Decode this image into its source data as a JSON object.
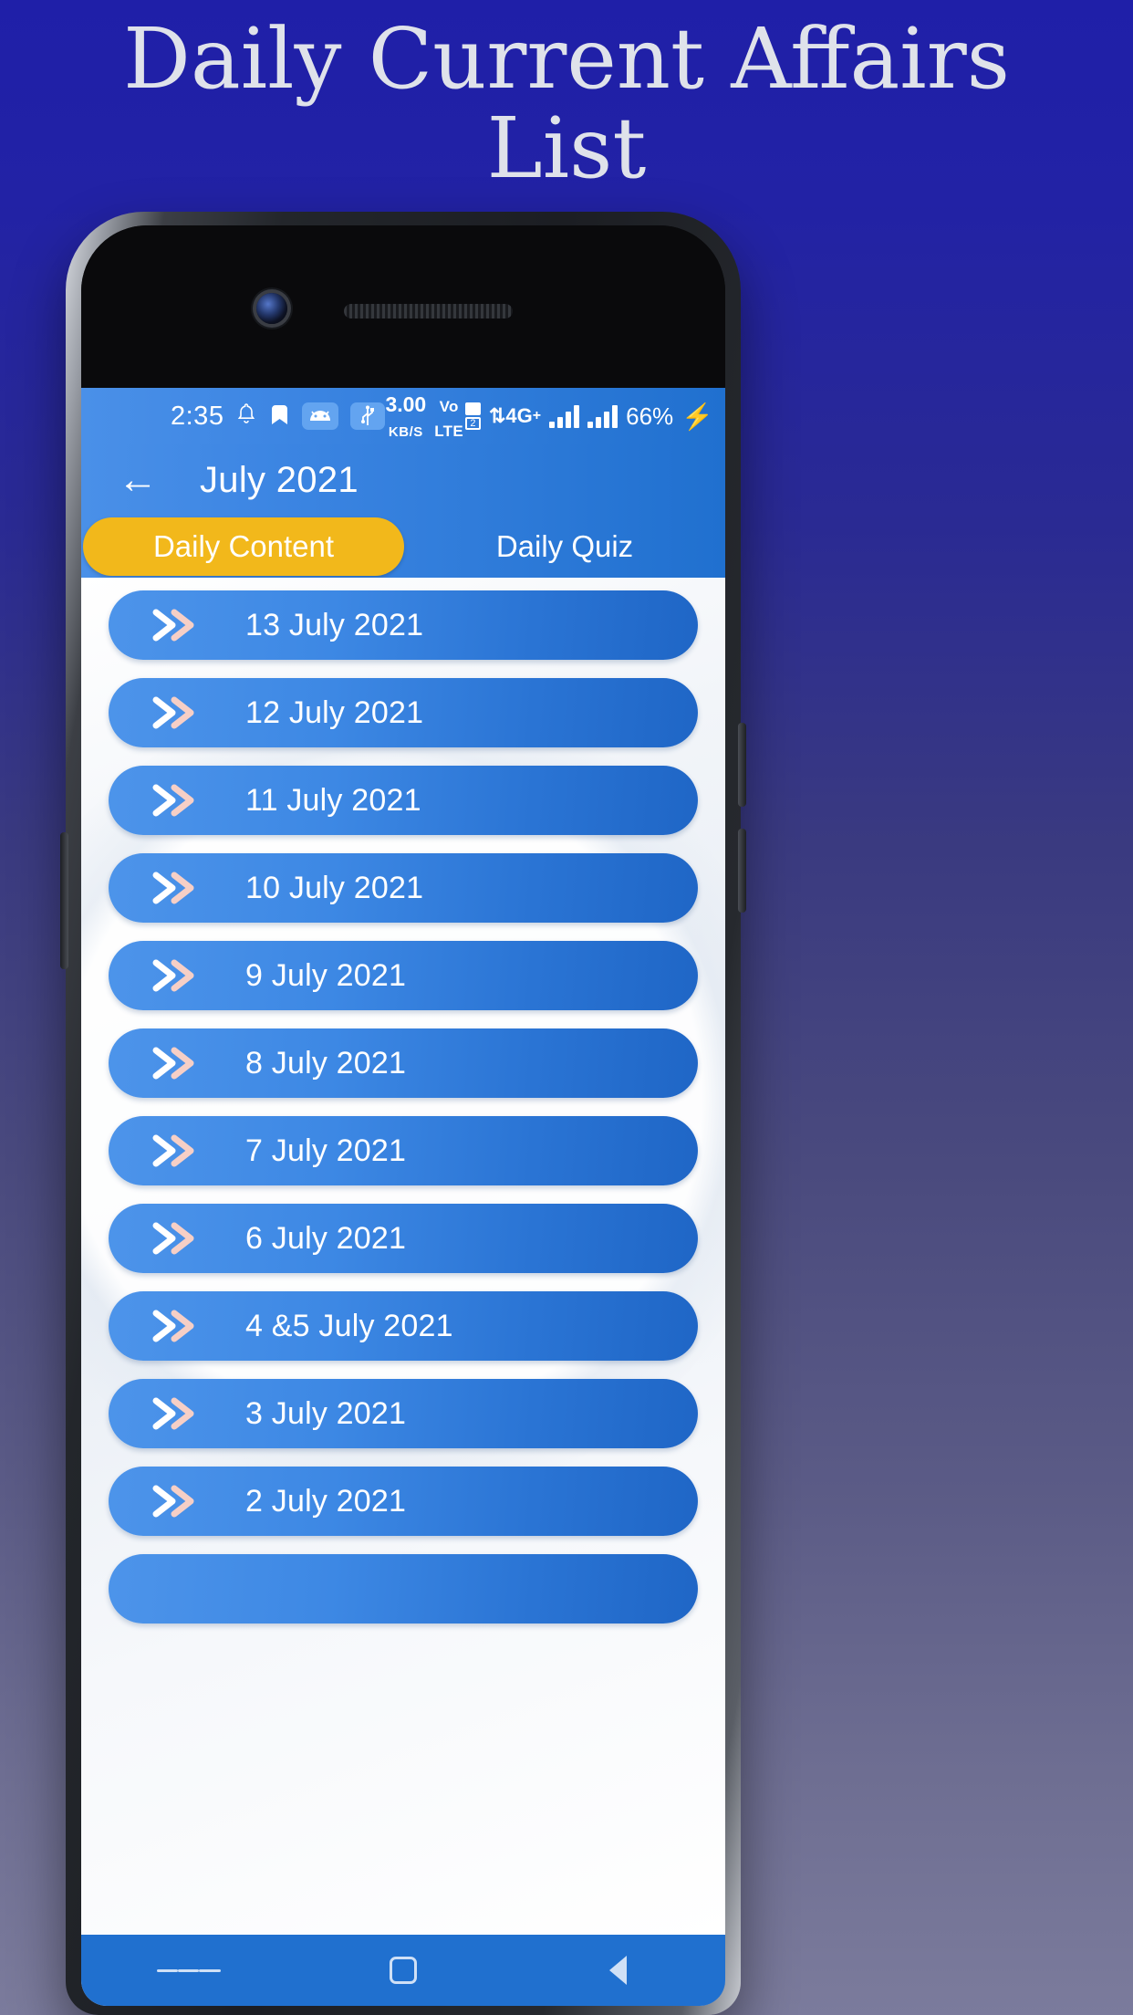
{
  "hero": {
    "title_line1": "Daily Current Affairs",
    "title_line2": "List"
  },
  "status_bar": {
    "time": "2:35",
    "icons": [
      "bell-icon",
      "bookmark-icon",
      "android-icon",
      "usb-icon"
    ],
    "android_glyph": "■",
    "usb_glyph": "Ψ",
    "bell_glyph": "⊗",
    "bookmark_glyph": "⬟",
    "data_rate_value": "3.00",
    "data_rate_unit": "KB/S",
    "volte_top": "Vo",
    "volte_bottom": "LTE",
    "sim1": "1",
    "sim2": "2",
    "network": "4G",
    "network_plus": "+",
    "battery": "66%",
    "charging_glyph": "⚡"
  },
  "app_bar": {
    "back_glyph": "←",
    "title": "July 2021"
  },
  "tabs": [
    {
      "label": "Daily Content",
      "active": true
    },
    {
      "label": "Daily Quiz",
      "active": false
    }
  ],
  "list": {
    "items": [
      {
        "label": "13 July 2021"
      },
      {
        "label": "12 July 2021"
      },
      {
        "label": "11 July 2021"
      },
      {
        "label": "10 July 2021"
      },
      {
        "label": "9 July 2021"
      },
      {
        "label": "8 July 2021"
      },
      {
        "label": "7 July 2021"
      },
      {
        "label": "6 July 2021"
      },
      {
        "label": "4 &5 July 2021"
      },
      {
        "label": "3 July 2021"
      },
      {
        "label": "2 July 2021"
      },
      {
        "label": ""
      }
    ]
  },
  "nav_bar": {
    "recents": "menu-icon",
    "home": "home-icon",
    "back": "back-icon"
  },
  "colors": {
    "page_bg_top": "#1f1fa8",
    "app_blue": "#2070cf",
    "app_blue_light": "#4a90e8",
    "tab_active": "#f2b81b",
    "chevron_white": "#ffffff",
    "chevron_pink": "#f6cfc6",
    "text_white": "#ffffff",
    "hero_text": "#dfe2ea"
  }
}
